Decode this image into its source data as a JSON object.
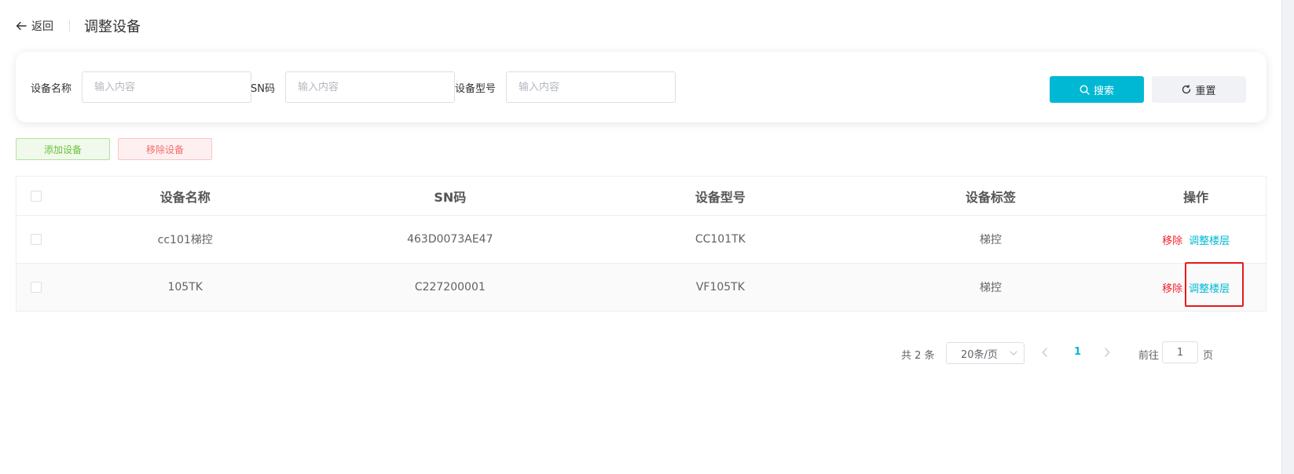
{
  "header": {
    "back_label": "返回",
    "title": "调整设备"
  },
  "search": {
    "fields": [
      {
        "label": "设备名称",
        "placeholder": "输入内容",
        "value": ""
      },
      {
        "label": "SN码",
        "placeholder": "输入内容",
        "value": ""
      },
      {
        "label": "设备型号",
        "placeholder": "输入内容",
        "value": ""
      }
    ],
    "search_label": "搜索",
    "reset_label": "重置"
  },
  "actions": {
    "add_label": "添加设备",
    "remove_label": "移除设备"
  },
  "table": {
    "columns": [
      "设备名称",
      "SN码",
      "设备型号",
      "设备标签",
      "操作"
    ],
    "rows": [
      {
        "name": "cc101梯控",
        "sn": "463D0073AE47",
        "model": "CC101TK",
        "tag": "梯控",
        "op_remove": "移除",
        "op_adjust": "调整楼层"
      },
      {
        "name": "105TK",
        "sn": "C227200001",
        "model": "VF105TK",
        "tag": "梯控",
        "op_remove": "移除",
        "op_adjust": "调整楼层"
      }
    ]
  },
  "pagination": {
    "total_label": "共 2 条",
    "page_size": "20条/页",
    "current_page": "1",
    "goto_label": "前往",
    "goto_value": "1",
    "page_unit": "页"
  },
  "colors": {
    "accent": "#00b8d4",
    "danger": "#f5222d",
    "success": "#67c23a",
    "highlight": "#e8191c"
  }
}
